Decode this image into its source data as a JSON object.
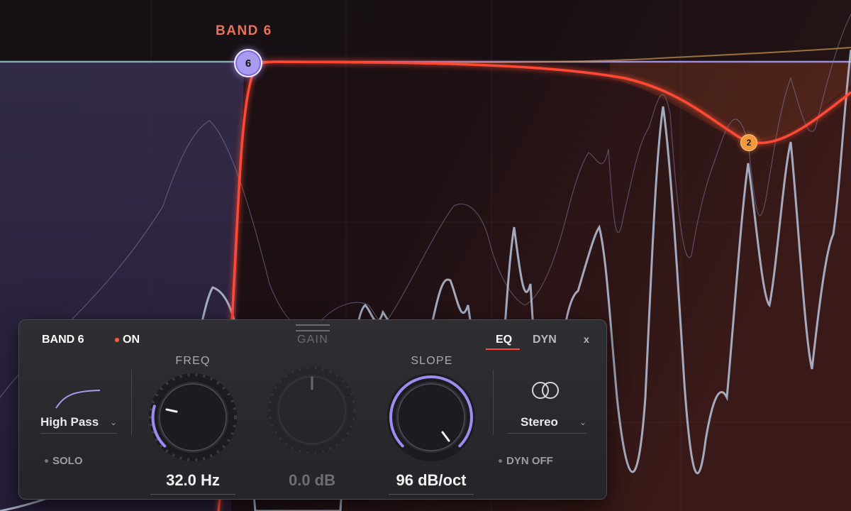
{
  "display": {
    "band_label": "BAND 6",
    "node_6": "6",
    "node_2": "2",
    "colors": {
      "band6": "#a99af0",
      "band2": "#f09a3c",
      "curve": "#ff4a36"
    }
  },
  "panel": {
    "title": "BAND 6",
    "on_label": "ON",
    "tabs": {
      "eq": "EQ",
      "dyn": "DYN",
      "active": "EQ"
    },
    "close": "x",
    "filter_type": "High Pass",
    "solo_label": "SOLO",
    "freq": {
      "label": "FREQ",
      "value": "32.0 Hz"
    },
    "gain": {
      "label": "GAIN",
      "value": "0.0 dB"
    },
    "slope": {
      "label": "SLOPE",
      "value": "96 dB/oct"
    },
    "channel_mode": "Stereo",
    "dyn_off_label": "DYN OFF",
    "icons": [
      "high-pass-shape-icon",
      "stereo-rings-icon",
      "chevron-down-icon"
    ]
  }
}
